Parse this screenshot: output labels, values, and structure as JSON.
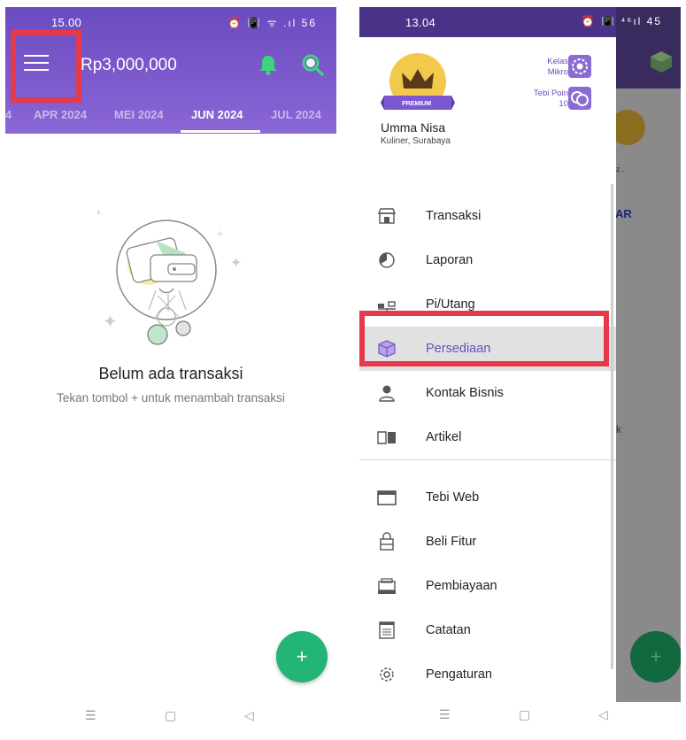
{
  "left": {
    "status": {
      "time": "15.00",
      "icons": "⏰ 📳 ᯤ .ıl 56"
    },
    "balance": "Rp3,000,000",
    "tabs": [
      {
        "label": "4",
        "active": false
      },
      {
        "label": "APR 2024",
        "active": false
      },
      {
        "label": "MEI 2024",
        "active": false
      },
      {
        "label": "JUN 2024",
        "active": true
      },
      {
        "label": "JUL 2024",
        "active": false
      }
    ],
    "empty_title": "Belum ada transaksi",
    "empty_subtitle": "Tekan tombol + untuk menambah transaksi",
    "fab_label": "+",
    "accent": "#7b58cf",
    "fab_color": "#22b573",
    "highlight_color": "#e43a4c"
  },
  "right": {
    "status": {
      "time": "13.04",
      "icons": "⏰ 📳 ⁴⁶ıl 45"
    },
    "badge": "PREMIUM",
    "user_name": "Umma Nisa",
    "user_location": "Kuliner, Surabaya",
    "level_label_1": "Kelas",
    "level_label_2": "Mikro",
    "points_label": "Tebi Poin",
    "points_value": "10",
    "menu_primary": [
      {
        "label": "Transaksi",
        "icon": "store-icon"
      },
      {
        "label": "Laporan",
        "icon": "pie-chart-icon"
      },
      {
        "label": "Pi/Utang",
        "icon": "scale-icon"
      },
      {
        "label": "Persediaan",
        "icon": "box-icon",
        "selected": true
      },
      {
        "label": "Kontak Bisnis",
        "icon": "person-icon"
      },
      {
        "label": "Artikel",
        "icon": "book-icon"
      }
    ],
    "menu_secondary": [
      {
        "label": "Tebi Web",
        "icon": "browser-icon"
      },
      {
        "label": "Beli Fitur",
        "icon": "bag-icon"
      },
      {
        "label": "Pembiayaan",
        "icon": "money-icon"
      },
      {
        "label": "Catatan",
        "icon": "note-icon"
      },
      {
        "label": "Pengaturan",
        "icon": "gear-icon"
      }
    ],
    "bg_text_1": "z..",
    "bg_text_2": "AR",
    "bg_text_3": "k",
    "fab_label": "+"
  }
}
